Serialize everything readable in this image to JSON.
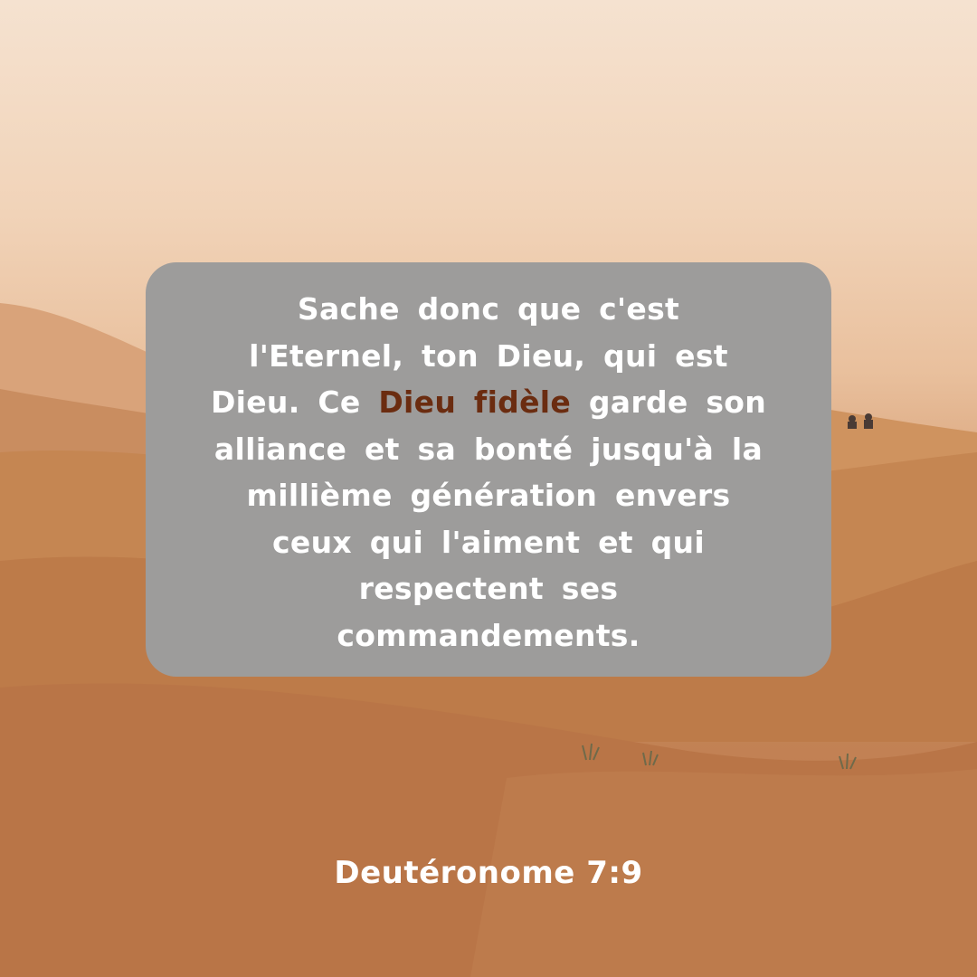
{
  "verse": {
    "lines": [
      "Sache donc que c'est",
      "l'Eternel, ton Dieu, qui est",
      "garde son",
      "alliance et sa bonté jusqu'à la",
      "millième génération envers",
      "ceux qui l'aiment et qui",
      "respectent ses",
      "commandements."
    ],
    "line3_prefix": "Dieu. Ce",
    "highlight": "Dieu fidèle"
  },
  "reference": "Deutéronome 7:9",
  "colors": {
    "card_background": "#9d9c9b",
    "text": "#ffffff",
    "highlight": "#6b2c10",
    "sky": "#f5e2d0",
    "sand": "#c07e50"
  }
}
